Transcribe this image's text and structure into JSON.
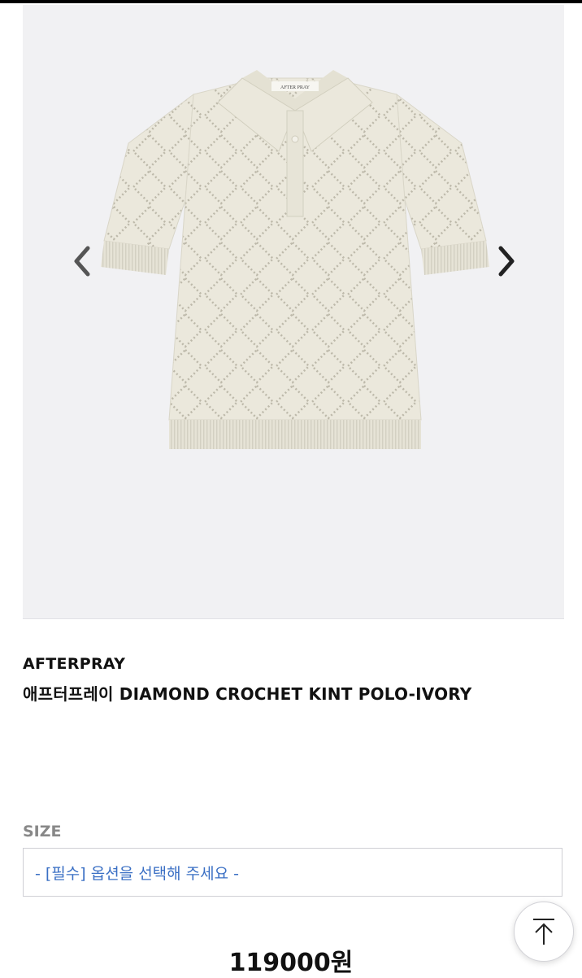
{
  "product": {
    "brand": "AFTERPRAY",
    "name": "애프터프레이 DIAMOND CROCHET KINT POLO-IVORY",
    "label_text": "AFTER PRAY"
  },
  "gallery": {
    "prev_icon": "chevron-left-icon",
    "next_icon": "chevron-right-icon"
  },
  "options": {
    "size_label": "SIZE",
    "size_placeholder": "- [필수] 옵션을 선택해 주세요 -"
  },
  "price": "119000원",
  "scroll_top_icon": "arrow-up-icon",
  "colors": {
    "select_text": "#3a6fc4",
    "gallery_bg": "#f1f1f3",
    "knit": "#ebe8dc"
  }
}
